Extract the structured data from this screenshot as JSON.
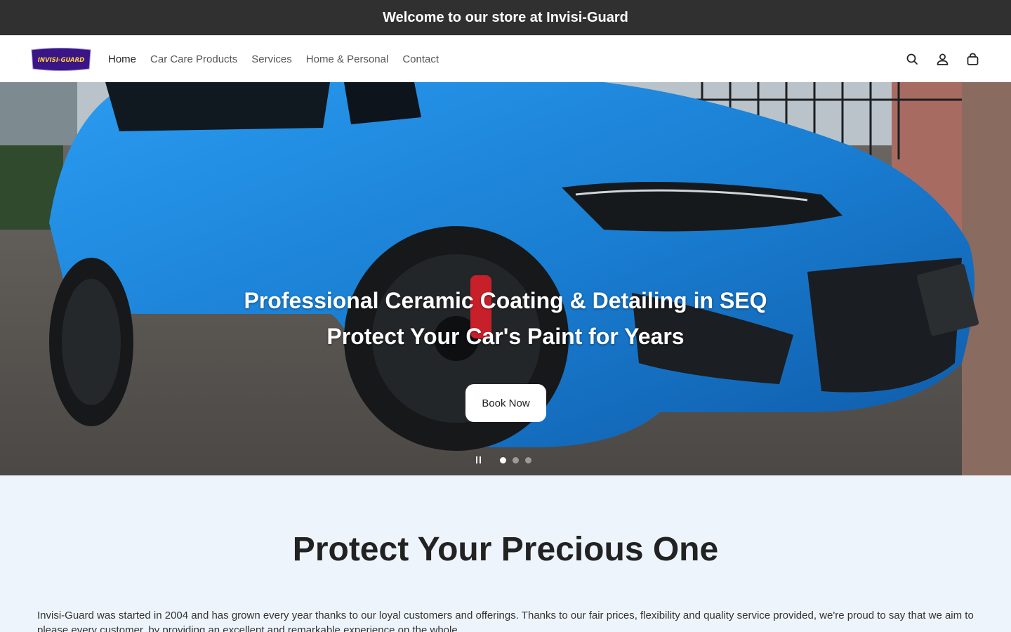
{
  "announcement": {
    "text": "Welcome to our store at Invisi-Guard"
  },
  "header": {
    "logo_text": "INVISI-GUARD",
    "nav": [
      {
        "label": "Home",
        "active": true
      },
      {
        "label": "Car Care Products"
      },
      {
        "label": "Services"
      },
      {
        "label": "Home & Personal"
      },
      {
        "label": "Contact"
      }
    ],
    "icons": [
      "search-icon",
      "account-icon",
      "cart-icon"
    ]
  },
  "hero": {
    "line1": "Professional Ceramic Coating & Detailing in SEQ",
    "line2": "Protect Your Car's Paint for Years",
    "button_label": "Book Now",
    "slide_count": 3,
    "active_slide": 1
  },
  "about": {
    "heading": "Protect Your Precious One",
    "body": "Invisi-Guard was started in 2004 and has grown every year thanks to our loyal customers and offerings. Thanks to our fair prices, flexibility and quality service provided, we're proud to say that we aim to please every customer, by providing an excellent and remarkable experience on the whole."
  },
  "colors": {
    "announcement_bg": "#303030",
    "page_bg": "#eef4fb",
    "logo_purple": "#3a1585",
    "car_blue": "#1f86d8"
  }
}
